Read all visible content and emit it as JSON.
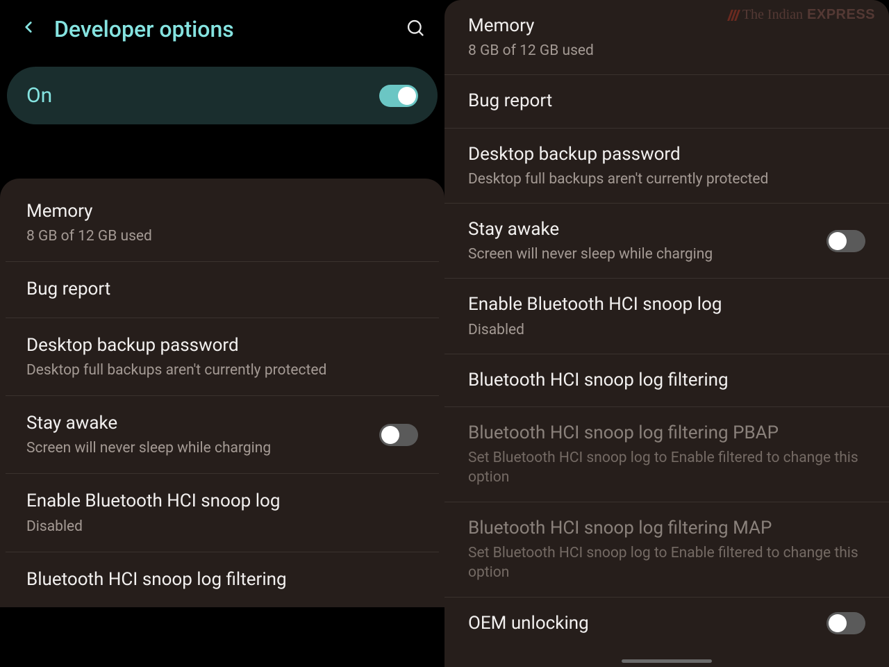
{
  "header": {
    "title": "Developer options"
  },
  "master_toggle": {
    "label": "On",
    "state": "on"
  },
  "left_rows": [
    {
      "title": "Memory",
      "sub": "8 GB of 12 GB used"
    },
    {
      "title": "Bug report"
    },
    {
      "title": "Desktop backup password",
      "sub": "Desktop full backups aren't currently protected"
    },
    {
      "title": "Stay awake",
      "sub": "Screen will never sleep while charging",
      "toggle": "off"
    },
    {
      "title": "Enable Bluetooth HCI snoop log",
      "sub": "Disabled"
    },
    {
      "title": "Bluetooth HCI snoop log filtering"
    }
  ],
  "right_rows": [
    {
      "title": "Memory",
      "sub": "8 GB of 12 GB used"
    },
    {
      "title": "Bug report"
    },
    {
      "title": "Desktop backup password",
      "sub": "Desktop full backups aren't currently protected"
    },
    {
      "title": "Stay awake",
      "sub": "Screen will never sleep while charging",
      "toggle": "off"
    },
    {
      "title": "Enable Bluetooth HCI snoop log",
      "sub": "Disabled"
    },
    {
      "title": "Bluetooth HCI snoop log filtering"
    },
    {
      "title": "Bluetooth HCI snoop log filtering PBAP",
      "sub": "Set Bluetooth HCI snoop log to Enable filtered to change this option",
      "dim": true
    },
    {
      "title": "Bluetooth HCI snoop log filtering MAP",
      "sub": "Set Bluetooth HCI snoop log to Enable filtered to change this option",
      "dim": true
    },
    {
      "title": "OEM unlocking",
      "toggle": "off"
    }
  ],
  "watermark": {
    "prefix": "The Indian",
    "bold": "EXPRESS"
  }
}
